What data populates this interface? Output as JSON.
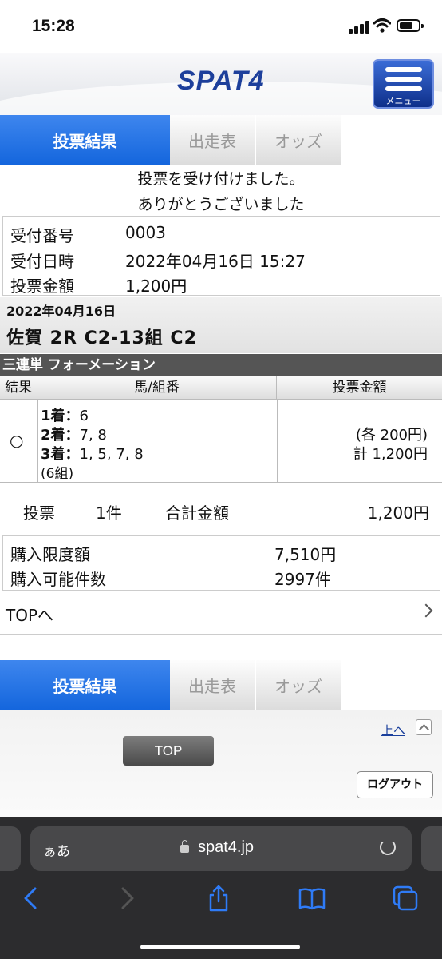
{
  "status_bar": {
    "time": "15:28"
  },
  "header": {
    "logo": "SPAT4",
    "menu_label": "メニュー"
  },
  "tabs": [
    {
      "label": "投票結果",
      "active": true
    },
    {
      "label": "出走表",
      "active": false
    },
    {
      "label": "オッズ",
      "active": false
    }
  ],
  "message": {
    "line1": "投票を受け付けました。",
    "line2": "ありがとうございました"
  },
  "receipt": {
    "number_label": "受付番号",
    "number": "0003",
    "datetime_label": "受付日時",
    "datetime": "2022年04月16日 15:27",
    "amount_label": "投票金額",
    "amount": "1,200円"
  },
  "race": {
    "date": "2022年04月16日",
    "title": "佐賀 2R C2-13組 C2"
  },
  "bet": {
    "type": "三連単 フォーメーション",
    "headers": {
      "result": "結果",
      "combo": "馬/組番",
      "amount": "投票金額"
    },
    "result_mark": "○",
    "first_label": "1着：",
    "first": "6",
    "second_label": "2着：",
    "second": "7, 8",
    "third_label": "3着：",
    "third": "1, 5, 7, 8",
    "combos": "(6組)",
    "each": "(各 200円)",
    "total": "計 1,200円"
  },
  "summary": {
    "vote_label": "投票",
    "count": "1件",
    "total_label": "合計金額",
    "total": "1,200円"
  },
  "limits": {
    "limit_label": "購入限度額",
    "limit": "7,510円",
    "count_label": "購入可能件数",
    "count": "2997件"
  },
  "top_link": "TOPへ",
  "footer": {
    "up_link": "上へ",
    "top_button": "TOP",
    "logout_button": "ログアウト"
  },
  "browser": {
    "aa": "ぁあ",
    "url": "spat4.jp"
  }
}
